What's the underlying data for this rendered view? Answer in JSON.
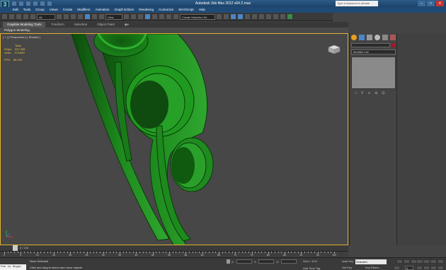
{
  "app": {
    "title": "Autodesk 3ds Max 2012 x64     Z.max",
    "logo": "3"
  },
  "search": {
    "placeholder": "Type a keyword or phrase"
  },
  "menu": [
    "Edit",
    "Tools",
    "Group",
    "Views",
    "Create",
    "Modifiers",
    "Animation",
    "Graph Editors",
    "Rendering",
    "Customize",
    "MAXScript",
    "Help"
  ],
  "toolbar": {
    "filter": "All",
    "ref_coord": "View",
    "sel_set": "Create Selection Se"
  },
  "ribbon": {
    "tabs": [
      "Graphite Modeling Tools",
      "Freeform",
      "Selection",
      "Object Paint"
    ],
    "sub": "Polygon Modeling"
  },
  "viewport": {
    "label": "[ + ] [ Perspective ] [ Shaded ]",
    "stats": {
      "total_label": "Total",
      "polys_label": "Polys:",
      "polys_value": "347,338",
      "verts_label": "Verts:",
      "verts_value": "173,680",
      "fps_label": "FPS:",
      "fps_value": "86.109"
    },
    "object_color": "#1e8a1e"
  },
  "command_panel": {
    "modifier_list": "Modifier List",
    "color_swatch": "#9a1a2a"
  },
  "timeline": {
    "slider": "0 / 100",
    "ticks": [
      "0",
      "5",
      "10",
      "15",
      "20",
      "25",
      "30",
      "35",
      "40",
      "45",
      "50",
      "55",
      "60",
      "65",
      "70",
      "75",
      "80",
      "85",
      "90",
      "95",
      "100"
    ]
  },
  "status": {
    "maxscript": "Fee to Skype",
    "none_selected": "None Selected",
    "prompt": "Click and drag to select and move objects",
    "x_label": "X:",
    "y_label": "Y:",
    "z_label": "Z:",
    "grid": "Grid = 10.0",
    "add_time_tag": "Add Time Tag",
    "auto_key": "Auto Key",
    "set_key": "Set Key",
    "selection": "Selected",
    "key_filters": "Key Filters...",
    "frame": "0"
  }
}
